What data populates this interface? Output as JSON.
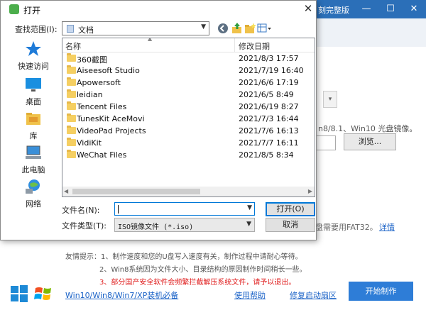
{
  "background_app": {
    "title": "刻完整版",
    "hint_text": "n8/8.1、Win10 光盘镜像。",
    "browse_label": "浏览...",
    "fat_note": "盘需要用FAT32。",
    "detail_link": "详情",
    "tips": [
      "友情提示：1、制作速度和您的U盘写入速度有关，制作过程中请耐心等待。",
      "2、Win8系统因为文件大小、目录结构的原因制作时间稍长一些。",
      "3、部分国产安全软件会频繁拦截解压系统文件，请予以退出。"
    ],
    "links": [
      "Win10/Win8/Win7/XP装机必备",
      "使用帮助",
      "修复启动扇区"
    ],
    "start_button": "开始制作",
    "colors": {
      "accent": "#2e7dd7",
      "warning": "#e02020",
      "link": "#1a62c7"
    }
  },
  "dialog": {
    "title": "打开",
    "look_in_label": "查找范围(I):",
    "look_in_value": "文档",
    "places": [
      {
        "label": "快速访问",
        "icon": "star-icon"
      },
      {
        "label": "桌面",
        "icon": "desktop-icon"
      },
      {
        "label": "库",
        "icon": "library-icon"
      },
      {
        "label": "此电脑",
        "icon": "computer-icon"
      },
      {
        "label": "网络",
        "icon": "network-icon"
      }
    ],
    "columns": {
      "name": "名称",
      "date": "修改日期"
    },
    "files": [
      {
        "name": "360截图",
        "date": "2021/8/3 17:57"
      },
      {
        "name": "Aiseesoft Studio",
        "date": "2021/7/19 16:40"
      },
      {
        "name": "Apowersoft",
        "date": "2021/6/6 17:19"
      },
      {
        "name": "leidian",
        "date": "2021/6/5 8:49"
      },
      {
        "name": "Tencent Files",
        "date": "2021/6/19 8:27"
      },
      {
        "name": "TunesKit AceMovi",
        "date": "2021/7/3 16:44"
      },
      {
        "name": "VideoPad Projects",
        "date": "2021/7/6 16:13"
      },
      {
        "name": "VidiKit",
        "date": "2021/7/7 16:11"
      },
      {
        "name": "WeChat Files",
        "date": "2021/8/5 8:34"
      }
    ],
    "filename_label": "文件名(N):",
    "filename_value": "",
    "filetype_label": "文件类型(T):",
    "filetype_value": "ISO镜像文件 (*.iso)",
    "open_label": "打开(O)",
    "cancel_label": "取消"
  }
}
